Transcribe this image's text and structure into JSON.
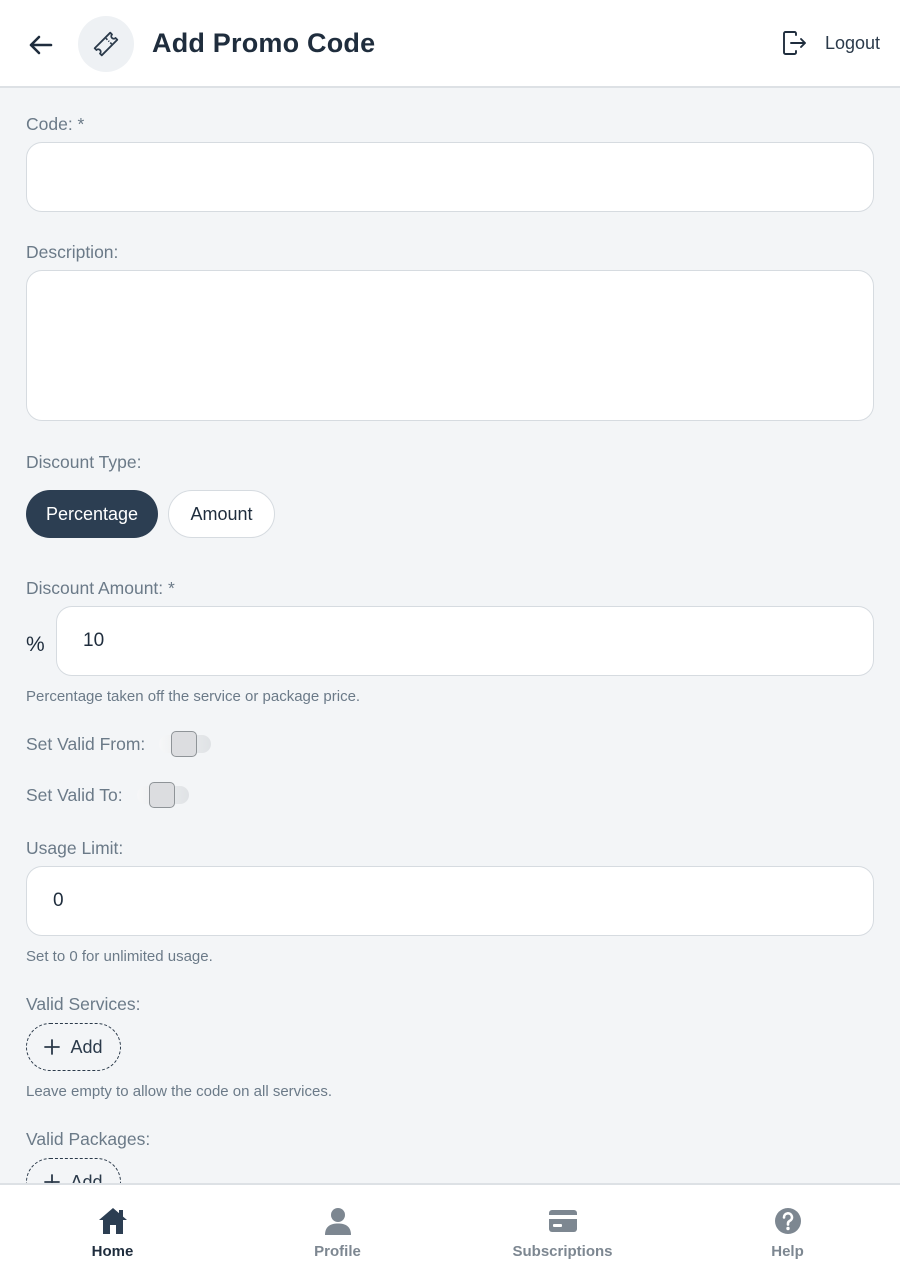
{
  "header": {
    "title": "Add Promo Code",
    "logout_label": "Logout"
  },
  "form": {
    "code": {
      "label": "Code: *",
      "value": ""
    },
    "description": {
      "label": "Description:",
      "value": ""
    },
    "discount_type": {
      "label": "Discount Type:",
      "options": [
        "Percentage",
        "Amount"
      ],
      "selected": "Percentage"
    },
    "discount_amount": {
      "label": "Discount Amount: *",
      "prefix": "%",
      "value": "10",
      "hint": "Percentage taken off the service or package price."
    },
    "valid_from": {
      "label": "Set Valid From:",
      "enabled": false
    },
    "valid_to": {
      "label": "Set Valid To:",
      "enabled": false
    },
    "usage_limit": {
      "label": "Usage Limit:",
      "value": "0",
      "hint": "Set to 0 for unlimited usage."
    },
    "valid_services": {
      "label": "Valid Services:",
      "add_label": "Add",
      "hint": "Leave empty to allow the code on all services."
    },
    "valid_packages": {
      "label": "Valid Packages:",
      "add_label": "Add"
    }
  },
  "nav": {
    "items": [
      {
        "label": "Home",
        "icon": "home-icon",
        "active": true
      },
      {
        "label": "Profile",
        "icon": "profile-icon",
        "active": false
      },
      {
        "label": "Subscriptions",
        "icon": "card-icon",
        "active": false
      },
      {
        "label": "Help",
        "icon": "help-icon",
        "active": false
      }
    ]
  },
  "colors": {
    "primary": "#2c3e52",
    "background": "#f3f5f7",
    "label": "#6b7a88"
  }
}
